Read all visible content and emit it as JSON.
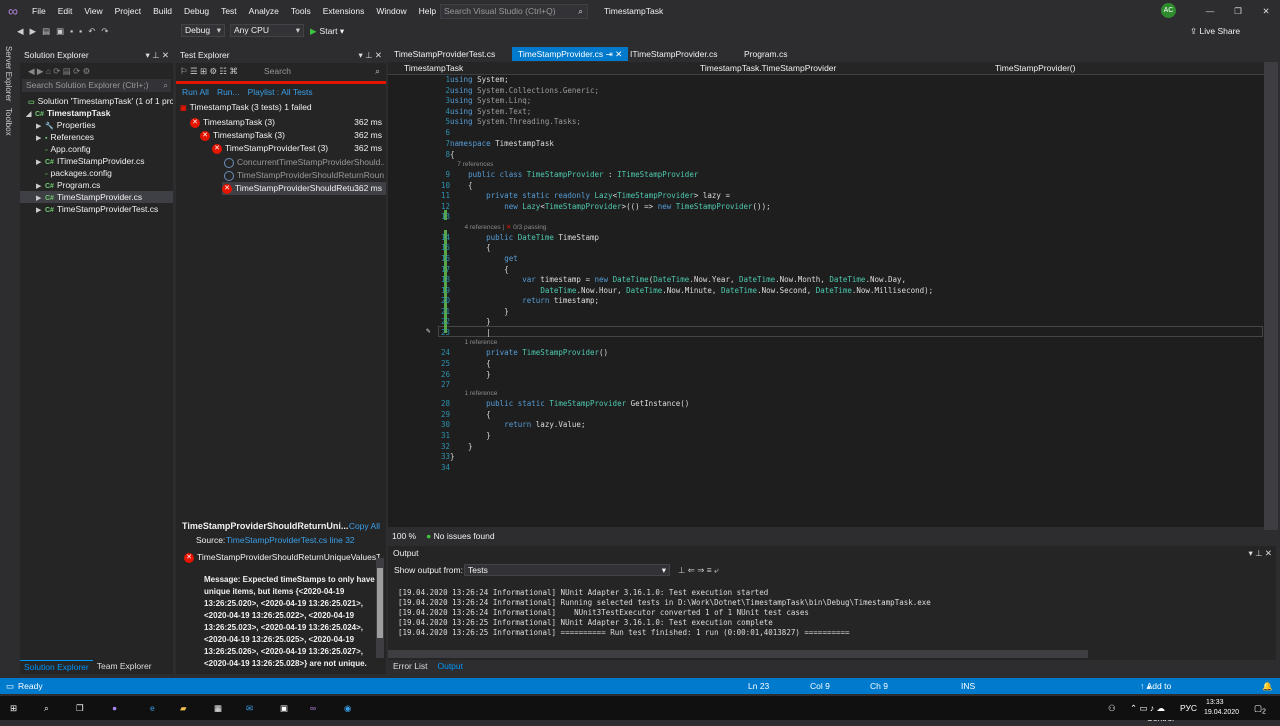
{
  "menu": [
    "File",
    "Edit",
    "View",
    "Project",
    "Build",
    "Debug",
    "Test",
    "Analyze",
    "Tools",
    "Extensions",
    "Window",
    "Help"
  ],
  "search": {
    "placeholder": "Search Visual Studio (Ctrl+Q)"
  },
  "project_name": "TimestampTask",
  "user_initials": "AC",
  "toolbar": {
    "config": "Debug",
    "platform": "Any CPU",
    "start": "Start",
    "live_share": "Live Share"
  },
  "side_strip": [
    "Server Explorer",
    "Toolbox"
  ],
  "solution_explorer": {
    "title": "Solution Explorer",
    "search_placeholder": "Search Solution Explorer (Ctrl+;)",
    "items": [
      {
        "label": "Solution 'TimestampTask' (1 of 1 project)"
      },
      {
        "label": "TimestampTask"
      },
      {
        "label": "Properties"
      },
      {
        "label": "References"
      },
      {
        "label": "App.config"
      },
      {
        "label": "ITimeStampProvider.cs"
      },
      {
        "label": "packages.config"
      },
      {
        "label": "Program.cs"
      },
      {
        "label": "TimeStampProvider.cs"
      },
      {
        "label": "TimeStampProviderTest.cs"
      }
    ],
    "tabs": [
      "Solution Explorer",
      "Team Explorer"
    ]
  },
  "test_explorer": {
    "title": "Test Explorer",
    "search_placeholder": "Search",
    "run_all": "Run All",
    "run": "Run...",
    "playlist": "Playlist : All Tests",
    "summary": "TimestampTask (3 tests) 1 failed",
    "rows": [
      {
        "label": "TimestampTask (3)",
        "dur": "362 ms"
      },
      {
        "label": "TimestampTask (3)",
        "dur": "362 ms"
      },
      {
        "label": "TimeStampProviderTest (3)",
        "dur": "362 ms"
      },
      {
        "label": "ConcurrentTimeStampProviderShould...",
        "dur": ""
      },
      {
        "label": "TimeStampProviderShouldReturnRoun...",
        "dur": ""
      },
      {
        "label": "TimeStampProviderShouldRetu...",
        "dur": "362 ms"
      }
    ],
    "detail": {
      "title": "TimeStampProviderShouldReturnUni...",
      "copy_all": "Copy All",
      "source_label": "Source:",
      "source_link": "TimeStampProviderTest.cs line 32",
      "test_name": "TimeStampProviderShouldReturnUniqueValuesTe",
      "message": "Message: Expected timeStamps to only have unique items, but items {<2020-04-19 13:26:25.020>, <2020-04-19 13:26:25.021>, <2020-04-19 13:26:25.022>, <2020-04-19 13:26:25.023>, <2020-04-19 13:26:25.024>, <2020-04-19 13:26:25.025>, <2020-04-19 13:26:25.026>, <2020-04-19 13:26:25.027>, <2020-04-19 13:26:25.028>} are not unique."
    }
  },
  "editor": {
    "tabs": [
      "TimeStampProviderTest.cs",
      "TimeStampProvider.cs",
      "ITimeStampProvider.cs",
      "Program.cs"
    ],
    "nav": [
      "TimestampTask",
      "TimestampTask.TimeStampProvider",
      "TimeStampProvider()"
    ],
    "zoom": "100 %",
    "issues": "No issues found",
    "lens": {
      "refs7": "7 references",
      "refs4": "4 references",
      "passing": "0/3 passing",
      "ref1": "1 reference"
    }
  },
  "output": {
    "title": "Output",
    "show_from_label": "Show output from:",
    "show_from": "Tests",
    "lines": [
      "[19.04.2020 13:26:24 Informational] NUnit Adapter 3.16.1.0: Test execution started",
      "[19.04.2020 13:26:24 Informational] Running selected tests in D:\\Work\\Dotnet\\TimestampTask\\bin\\Debug\\TimestampTask.exe",
      "[19.04.2020 13:26:24 Informational]    NUnit3TestExecutor converted 1 of 1 NUnit test cases",
      "[19.04.2020 13:26:25 Informational] NUnit Adapter 3.16.1.0: Test execution complete",
      "[19.04.2020 13:26:25 Informational] ========== Run test finished: 1 run (0:00:01,4013827) =========="
    ],
    "tabs": [
      "Error List",
      "Output"
    ]
  },
  "status": {
    "ready": "Ready",
    "ln": "Ln 23",
    "col": "Col 9",
    "ch": "Ch 9",
    "ins": "INS",
    "source_control": "Add to Source Control"
  },
  "taskbar": {
    "time": "13:33",
    "date": "19.04.2020",
    "lang": "РУС",
    "notif": "2"
  }
}
